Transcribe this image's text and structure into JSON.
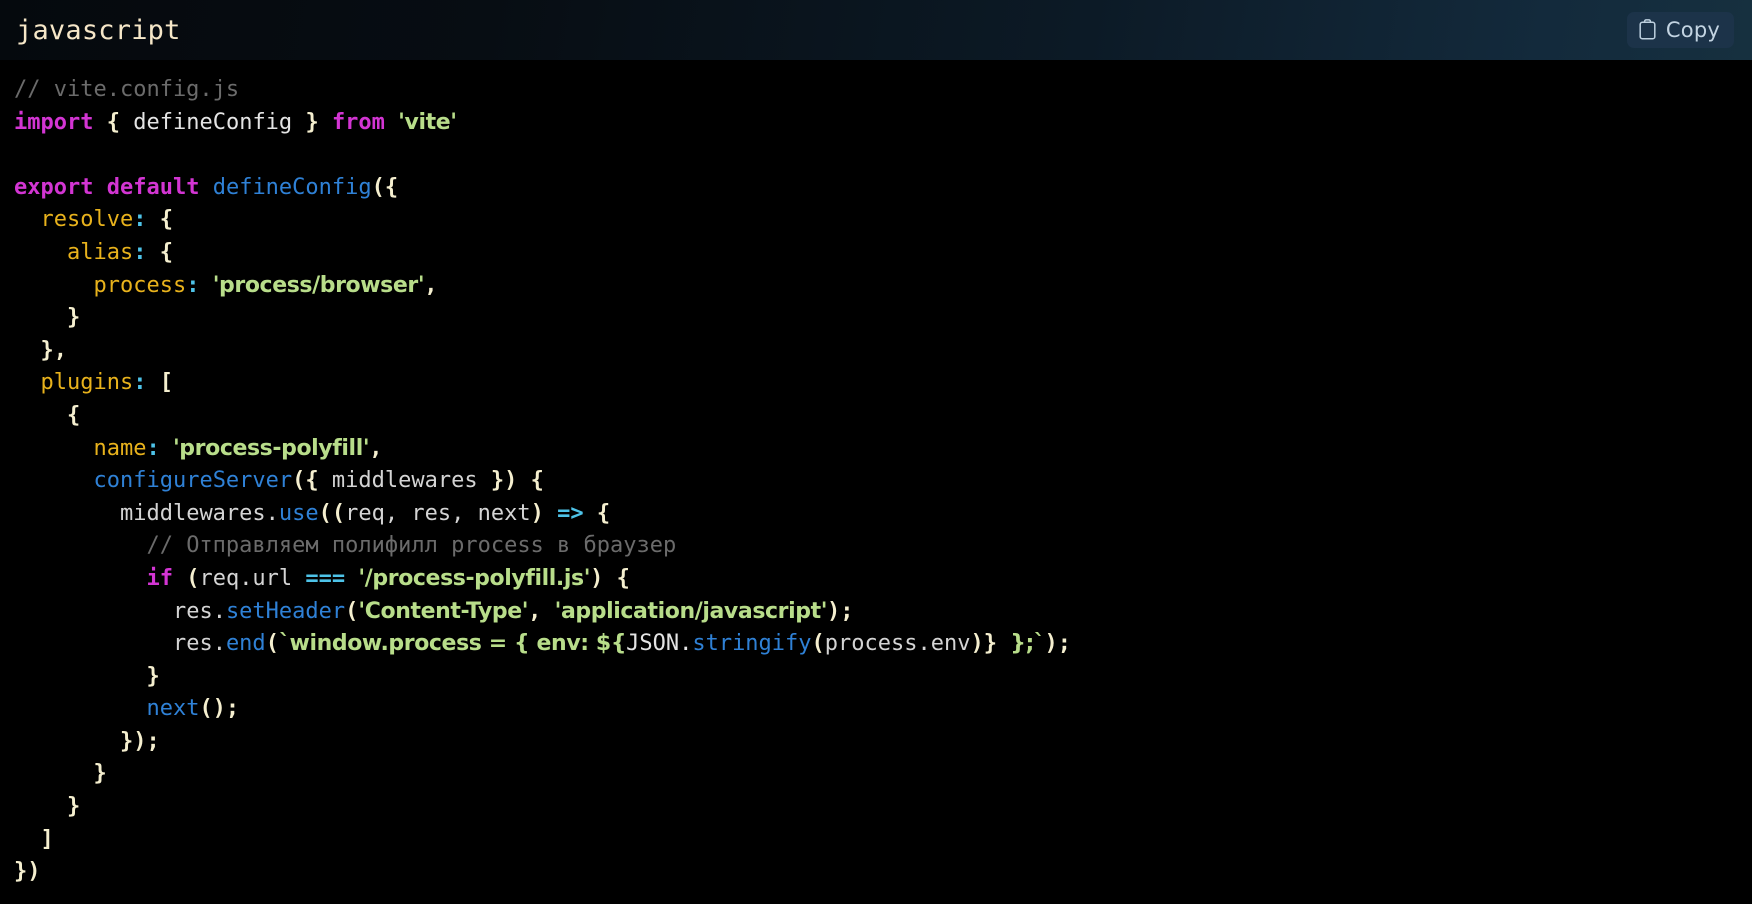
{
  "header": {
    "language": "javascript",
    "copy_label": "Copy",
    "copy_icon": "clipboard-icon"
  },
  "colors": {
    "background": "#000000",
    "header_gradient_start": "#05090d",
    "header_gradient_end": "#16303f",
    "lang_text": "#f6e7c8",
    "copy_button_bg": "#1c3349",
    "copy_button_text": "#c3d4e2",
    "comment": "#6b6b6b",
    "keyword": "#cd46d9",
    "function": "#2f81d6",
    "string": "#b8dd8a",
    "property_key": "#e8b21c",
    "punctuation": "#f5efcf",
    "operator": "#4ec3e8",
    "plain_text": "#d4d4d4"
  },
  "code": {
    "language": "javascript",
    "filename_comment": "// vite.config.js",
    "lines": [
      "// vite.config.js",
      "import { defineConfig } from 'vite'",
      "",
      "export default defineConfig({",
      "  resolve: {",
      "    alias: {",
      "      process: 'process/browser',",
      "    }",
      "  },",
      "  plugins: [",
      "    {",
      "      name: 'process-polyfill',",
      "      configureServer({ middlewares }) {",
      "        middlewares.use((req, res, next) => {",
      "          // Отправляем полифилл process в браузер",
      "          if (req.url === '/process-polyfill.js') {",
      "            res.setHeader('Content-Type', 'application/javascript');",
      "            res.end(`window.process = { env: ${JSON.stringify(process.env)} };`);",
      "          }",
      "          next();",
      "        });",
      "      }",
      "    }",
      "  ]",
      "})"
    ],
    "russian_comment": "// Отправляем полифилл process в браузер",
    "line_count": 25
  }
}
